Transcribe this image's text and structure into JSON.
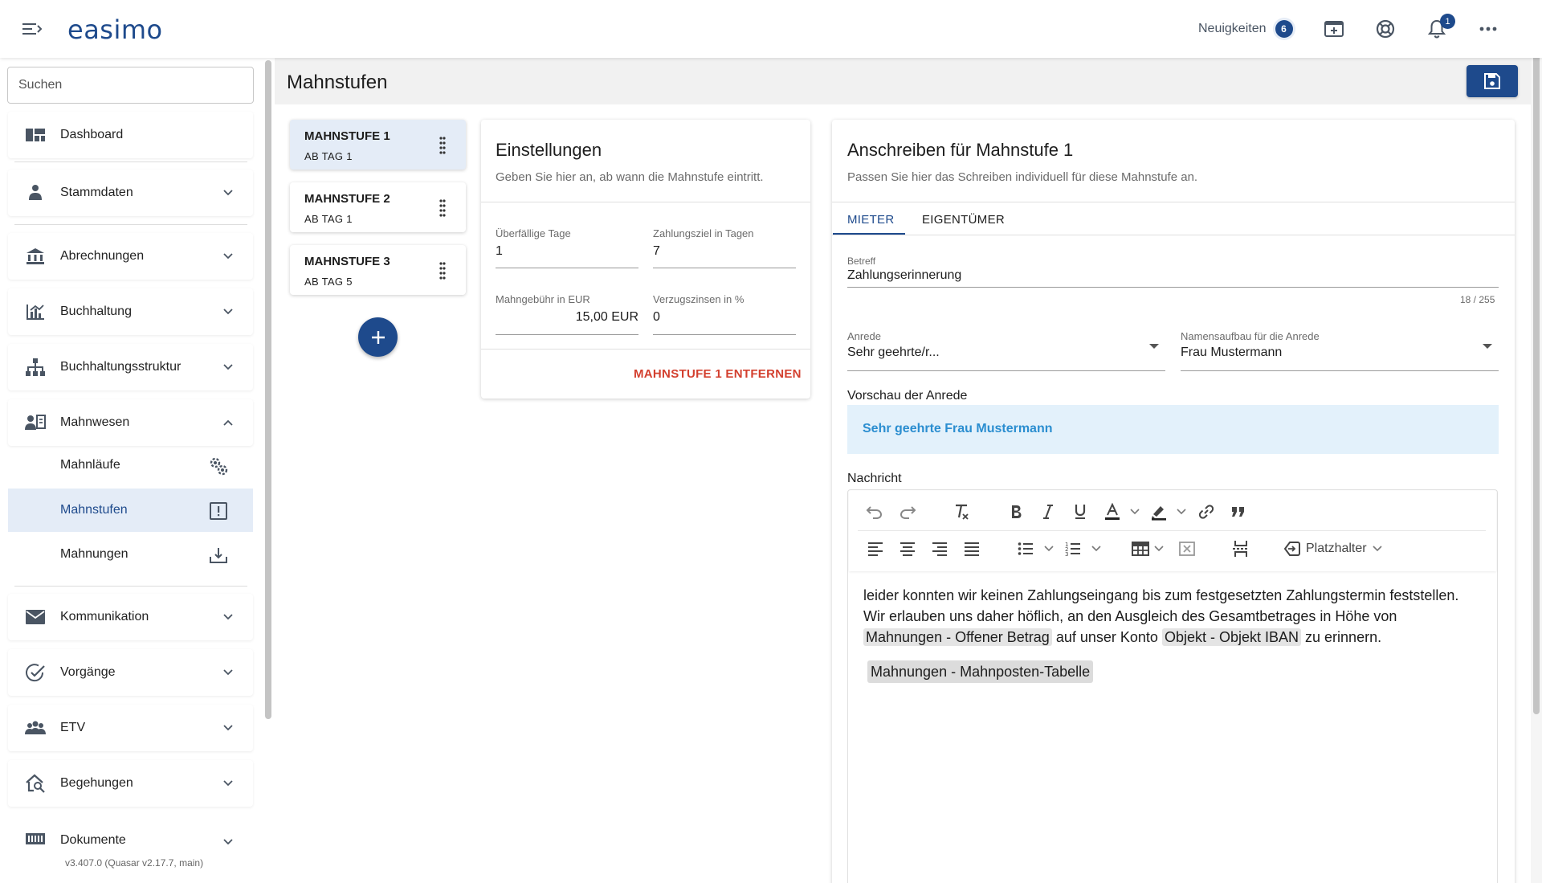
{
  "app": {
    "logo": "easimo",
    "version": "v3.407.0 (Quasar v2.17.7, main)"
  },
  "header": {
    "news_label": "Neuigkeiten",
    "news_count": "6",
    "notification_count": "1"
  },
  "sidebar": {
    "search_placeholder": "Suchen",
    "items": {
      "dashboard": "Dashboard",
      "stammdaten": "Stammdaten",
      "abrechnungen": "Abrechnungen",
      "buchhaltung": "Buchhaltung",
      "buchhaltungsstruktur": "Buchhaltungsstruktur",
      "mahnwesen": "Mahnwesen",
      "kommunikation": "Kommunikation",
      "vorgaenge": "Vorgänge",
      "etv": "ETV",
      "begehungen": "Begehungen",
      "dokumente": "Dokumente"
    },
    "mahnwesen_sub": {
      "mahnlaeufe": "Mahnläufe",
      "mahnstufen": "Mahnstufen",
      "mahnungen": "Mahnungen"
    }
  },
  "page": {
    "title": "Mahnstufen"
  },
  "stages": [
    {
      "title": "MAHNSTUFE 1",
      "subtitle": "AB TAG 1"
    },
    {
      "title": "MAHNSTUFE 2",
      "subtitle": "AB TAG 1"
    },
    {
      "title": "MAHNSTUFE 3",
      "subtitle": "AB TAG 5"
    }
  ],
  "settings": {
    "title": "Einstellungen",
    "subtitle": "Geben Sie hier an, ab wann die Mahnstufe eintritt.",
    "overdue_days_label": "Überfällige Tage",
    "overdue_days_value": "1",
    "payment_term_label": "Zahlungsziel in Tagen",
    "payment_term_value": "7",
    "fee_label": "Mahngebühr in EUR",
    "fee_value": "15,00 EUR",
    "interest_label": "Verzugszinsen in %",
    "interest_value": "0",
    "remove_label": "MAHNSTUFE 1 ENTFERNEN"
  },
  "letter": {
    "title": "Anschreiben für Mahnstufe 1",
    "subtitle": "Passen Sie hier das Schreiben individuell für diese Mahnstufe an.",
    "tabs": [
      "MIETER",
      "EIGENTÜMER"
    ],
    "subject_label": "Betreff",
    "subject_value": "Zahlungserinnerung",
    "subject_counter": "18 / 255",
    "salutation_label": "Anrede",
    "salutation_value": "Sehr geehrte/r...",
    "name_format_label": "Namensaufbau für die Anrede",
    "name_format_value": "Frau Mustermann",
    "preview_label": "Vorschau der Anrede",
    "preview_value": "Sehr geehrte Frau Mustermann",
    "message_label": "Nachricht",
    "placeholder_button": "Platzhalter",
    "body_line1": "leider konnten wir keinen Zahlungseingang bis zum festgesetzten Zahlungstermin feststellen. Wir erlauben uns daher höflich, an den Ausgleich des Gesamtbetrages in Höhe von",
    "chip_amount": "Mahnungen - Offener Betrag",
    "body_mid": "auf unser Konto",
    "chip_iban": "Objekt - Objekt IBAN",
    "body_end": "zu erinnern.",
    "chip_table": "Mahnungen - Mahnposten-Tabelle"
  },
  "colors": {
    "primary": "#1e4a8c",
    "danger": "#d33f2e",
    "preview_bg": "#e3f1fb",
    "preview_text": "#2b8ed0"
  }
}
